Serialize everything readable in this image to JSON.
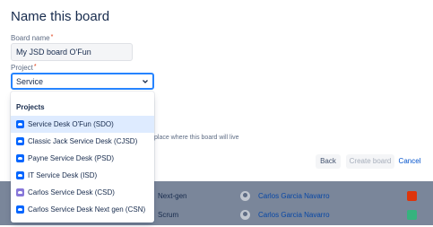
{
  "dialog": {
    "title": "Name this board",
    "board_name": {
      "label": "Board name",
      "required": "*",
      "value": "My JSD board O'Fun"
    },
    "project": {
      "label": "Project",
      "required": "*",
      "selected": "Service"
    },
    "helper_text": "place where this board will live",
    "buttons": {
      "back": "Back",
      "create": "Create board",
      "cancel": "Cancel"
    }
  },
  "dropdown": {
    "group_label": "Projects",
    "options": [
      {
        "label": "Service Desk O'Fun (SDO)",
        "icon": "project-avatar-icon",
        "highlighted": true
      },
      {
        "label": "Classic Jack Service Desk (CJSD)",
        "icon": "project-avatar-icon"
      },
      {
        "label": "Payne Service Desk (PSD)",
        "icon": "project-avatar-icon"
      },
      {
        "label": "IT Service Desk (ISD)",
        "icon": "project-avatar-icon"
      },
      {
        "label": "Carlos Service Desk (CSD)",
        "icon": "project-avatar-icon"
      },
      {
        "label": "Carlos Service Desk Next gen (CSN)",
        "icon": "project-avatar-icon"
      }
    ]
  },
  "background_table": {
    "rows": [
      {
        "type": "Next-gen",
        "owner": "Carlos Garcia Navarro"
      },
      {
        "type": "Scrum",
        "owner": "Carlos Garcia Navarro"
      }
    ]
  },
  "colors": {
    "primary": "#0052cc",
    "focus": "#2684ff",
    "highlight": "#deebff",
    "overlay": "#7a869a"
  }
}
